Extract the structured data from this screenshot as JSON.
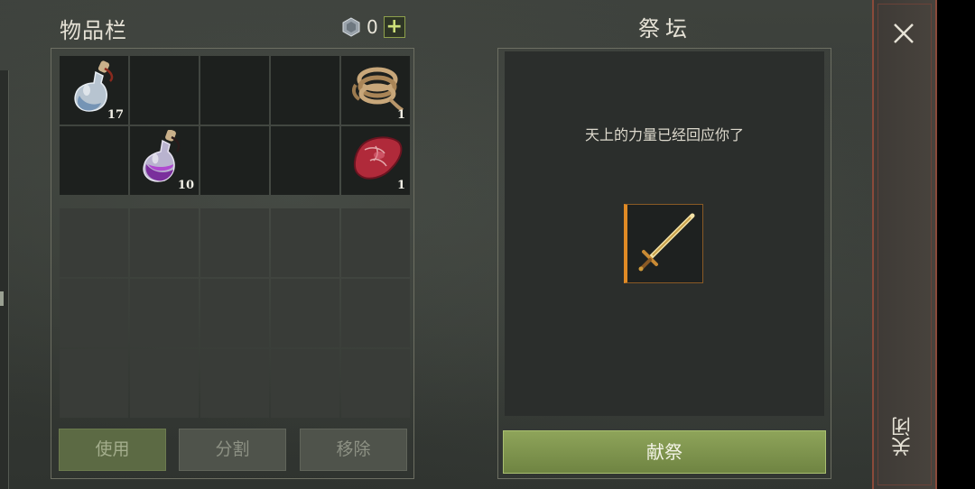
{
  "inventory": {
    "title": "物品栏",
    "currency_value": "0",
    "add_label": "+",
    "slots": [
      {
        "item": "water-flask-icon",
        "qty": "17"
      },
      {
        "item": null,
        "qty": ""
      },
      {
        "item": null,
        "qty": ""
      },
      {
        "item": null,
        "qty": ""
      },
      {
        "item": "rope-icon",
        "qty": "1"
      },
      {
        "item": null,
        "qty": ""
      },
      {
        "item": "purple-potion-icon",
        "qty": "10"
      },
      {
        "item": null,
        "qty": ""
      },
      {
        "item": null,
        "qty": ""
      },
      {
        "item": "raw-meat-icon",
        "qty": "1"
      }
    ],
    "buttons": {
      "use": "使用",
      "split": "分割",
      "remove": "移除"
    }
  },
  "altar": {
    "title": "祭坛",
    "message": "天上的力量已经回应你了",
    "offered_item": "golden-sword-icon",
    "offer_button": "献祭"
  },
  "close_label": "关闭",
  "colors": {
    "accent_green": "#8ea45a",
    "offer_slot_border": "#e08a25",
    "close_border": "#8a4a3a"
  }
}
